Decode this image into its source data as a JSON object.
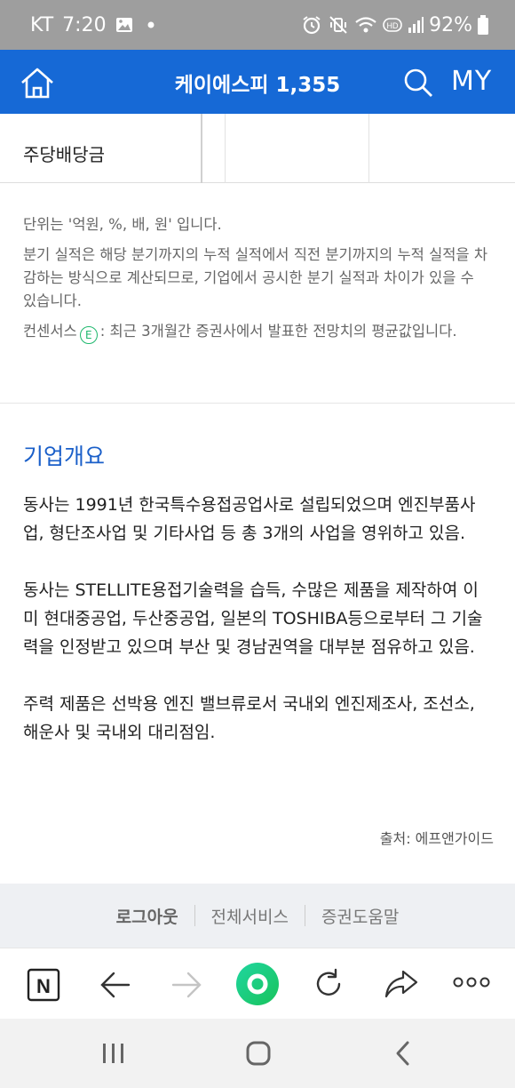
{
  "status_bar": {
    "carrier": "KT",
    "time": "7:20",
    "battery": "92%",
    "hd_label": "HD"
  },
  "header": {
    "title": "케이에스피 1,355",
    "my_label": "MY"
  },
  "table": {
    "row_label": "주당배당금"
  },
  "notes": {
    "unit_note": "단위는 '억원, %, 배, 원' 입니다.",
    "quarter_note": "분기 실적은 해당 분기까지의 누적 실적에서 직전 분기까지의 누적 실적을 차감하는 방식으로 계산되므로, 기업에서 공시한 분기 실적과 차이가 있을 수 있습니다.",
    "consensus_prefix": "컨센서스",
    "consensus_badge": "E",
    "consensus_text": ": 최근 3개월간 증권사에서 발표한 전망치의 평균값입니다."
  },
  "overview": {
    "title": "기업개요",
    "paragraphs": [
      "동사는 1991년 한국특수용접공업사로 설립되었으며 엔진부품사업, 형단조사업 및 기타사업 등 총 3개의 사업을 영위하고 있음.",
      "동사는 STELLITE용접기술력을 습득, 수많은 제품을 제작하여 이미 현대중공업, 두산중공업, 일본의 TOSHIBA등으로부터 그 기술력을 인정받고 있으며 부산 및 경남권역을 대부분 점유하고 있음.",
      "주력 제품은 선박용 엔진 밸브류로서 국내외 엔진제조사, 조선소, 해운사 및 국내외 대리점임."
    ],
    "source": "출처: 에프앤가이드"
  },
  "footer": {
    "logout": "로그아웃",
    "all_services": "전체서비스",
    "help": "증권도움말"
  },
  "browser": {
    "n_label": "N"
  },
  "colors": {
    "header_blue": "#1669d6",
    "title_blue": "#1a5fc9",
    "consensus_green": "#1fb86e"
  }
}
